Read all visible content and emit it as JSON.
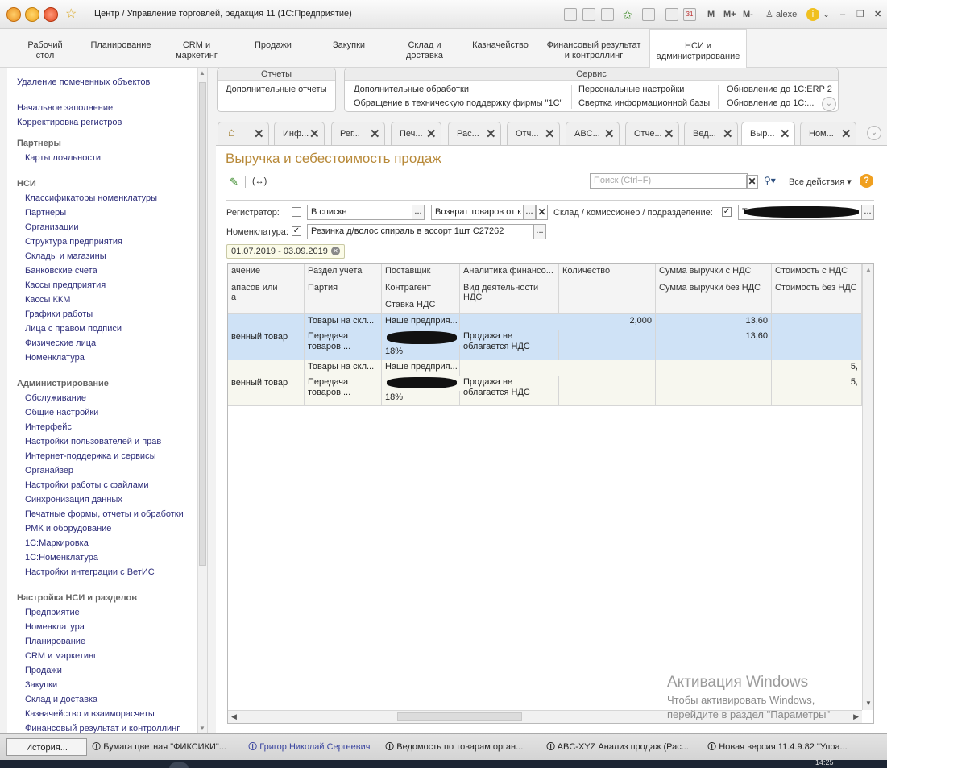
{
  "window": {
    "title": "Центр / Управление торговлей, редакция 11  (1С:Предприятие)",
    "toolbar_m": "M",
    "toolbar_mplus": "M+",
    "toolbar_mminus": "M-",
    "user": "alexei"
  },
  "sections": [
    {
      "label": "Рабочий\nстол"
    },
    {
      "label": "Планирование"
    },
    {
      "label": "CRM и\nмаркетинг"
    },
    {
      "label": "Продажи"
    },
    {
      "label": "Закупки"
    },
    {
      "label": "Склад и\nдоставка"
    },
    {
      "label": "Казначейство"
    },
    {
      "label": "Финансовый результат\nи контроллинг"
    },
    {
      "label": "НСИ и\nадминистрирование"
    }
  ],
  "left_panel": {
    "items_top": [
      "Удаление помеченных объектов",
      "Начальное заполнение",
      "Корректировка регистров"
    ],
    "partners_head": "Партнеры",
    "partners_items": [
      "Карты лояльности"
    ],
    "nsi_head": "НСИ",
    "nsi_items": [
      "Классификаторы номенклатуры",
      "Партнеры",
      "Организации",
      "Структура предприятия",
      "Склады и магазины",
      "Банковские счета",
      "Кассы предприятия",
      "Кассы ККМ",
      "Графики работы",
      "Лица с правом подписи",
      "Физические лица",
      "Номенклатура"
    ],
    "admin_head": "Администрирование",
    "admin_items": [
      "Обслуживание",
      "Общие настройки",
      "Интерфейс",
      "Настройки пользователей и прав",
      "Интернет-поддержка и сервисы",
      "Органайзер",
      "Настройки работы с файлами",
      "Синхронизация данных",
      "Печатные формы, отчеты и обработки",
      "РМК и оборудование",
      "1С:Маркировка",
      "1С:Номенклатура",
      "Настройки интеграции с ВетИС"
    ],
    "settings_head": "Настройка НСИ и разделов",
    "settings_items": [
      "Предприятие",
      "Номенклатура",
      "Планирование",
      "CRM и маркетинг",
      "Продажи",
      "Закупки",
      "Склад и доставка",
      "Казначейство и взаиморасчеты",
      "Финансовый результат и контроллинг"
    ]
  },
  "service": {
    "reports_head": "Отчеты",
    "reports_link": "Дополнительные отчеты",
    "service_head": "Сервис",
    "links": [
      "Дополнительные обработки",
      "Обращение в техническую поддержку фирмы \"1С\"",
      "Персональные настройки",
      "Свертка информационной базы",
      "Обновление до 1С:ERP 2",
      "Обновление до 1С:..."
    ]
  },
  "tabs": [
    "Инф...",
    "Рег...",
    "Печ...",
    "Рас...",
    "Отч...",
    "ABC...",
    "Отче...",
    "Вед...",
    "Выр...",
    "Ном..."
  ],
  "form": {
    "title": "Выручка и себестоимость продаж",
    "search_placeholder": "Поиск (Ctrl+F)",
    "all_actions": "Все действия",
    "help": "?",
    "registrator_label": "Регистратор:",
    "registrator_mode": "В списке",
    "registrator_value": "Возврат товаров от к",
    "warehouse_label": "Склад / комиссионер  / подразделение:",
    "warehouse_value": "Т",
    "nomenclature_label": "Номенклатура:",
    "nomenclature_value": "Резинка д/волос спираль в ассорт 1шт  С27262",
    "period": "01.07.2019 - 03.09.2019"
  },
  "grid": {
    "headers_row1": [
      "ачение",
      "Раздел учета",
      "Поставщик",
      "Аналитика финансо...",
      "Количество",
      "Сумма выручки с НДС",
      "Стоимость с НДС"
    ],
    "headers_row2": [
      "апасов или\nа",
      "Партия",
      "Контрагент",
      "Вид деятельности\nНДС",
      "",
      "Сумма выручки без НДС",
      "Стоимость без НДС"
    ],
    "headers_row3": [
      "",
      "",
      "Ставка НДС",
      "",
      "",
      "",
      ""
    ],
    "rows": [
      {
        "c0": "венный товар",
        "section": "Товары на скл...",
        "party": "Передача\nтоваров ...",
        "supplier": "Наше предприя...",
        "vat_rate": "18%",
        "activity": "Продажа не\nоблагается НДС",
        "qty": "2,000",
        "rev_vat": "13,60",
        "rev_novat": "13,60",
        "cost_vat": "",
        "cost_novat": ""
      },
      {
        "c0": "венный товар",
        "section": "Товары на скл...",
        "party": "Передача\nтоваров ...",
        "supplier": "Наше предприя...",
        "vat_rate": "18%",
        "activity": "Продажа не\nоблагается НДС",
        "qty": "",
        "rev_vat": "",
        "rev_novat": "",
        "cost_vat": "5,",
        "cost_novat": "5,"
      }
    ]
  },
  "activation": {
    "title": "Активация Windows",
    "line1": "Чтобы активировать Windows,",
    "line2": "перейдите в раздел \"Параметры\""
  },
  "taskbar": {
    "history": "История...",
    "items": [
      "Бумага цветная \"ФИКСИКИ\"...",
      "Григор Николай Сергеевич",
      "Ведомость по товарам орган...",
      "ABC-XYZ Анализ продаж (Рас...",
      "Новая версия 11.4.9.82 \"Упра..."
    ],
    "clock": "14:25"
  }
}
